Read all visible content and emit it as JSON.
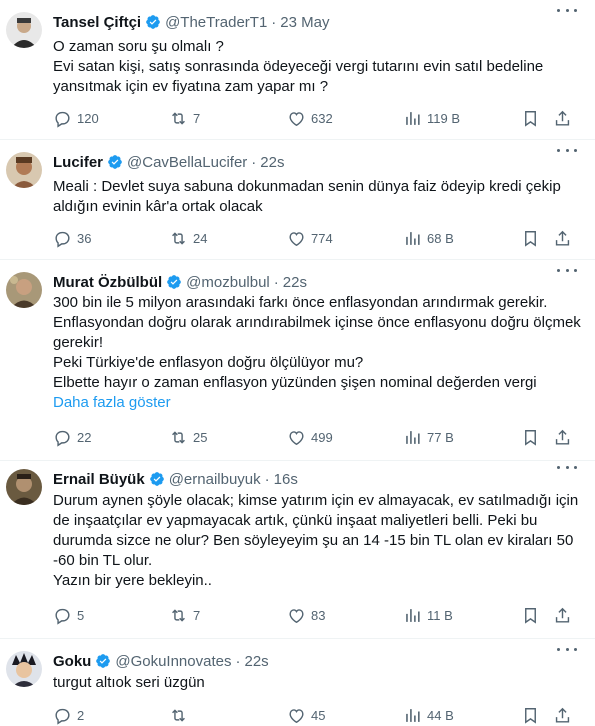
{
  "tweets": [
    {
      "name": "Tansel Çiftçi",
      "handle": "@TheTraderT1",
      "time": "23 May",
      "text": "O zaman soru şu olmalı ?\nEvi satan kişi, satış sonrasında ödeyeceği vergi tutarını evin satıl bedeline yansıtmak için ev fiyatına zam yapar mı ?",
      "show_more": "",
      "replies": "120",
      "retweets": "7",
      "likes": "632",
      "views": "119 B",
      "avatar_color": "#4a4a4a"
    },
    {
      "name": "Lucifer",
      "handle": "@CavBellaLucifer",
      "time": "22s",
      "text": "Meali : Devlet suya sabuna dokunmadan senin dünya faiz ödeyip kredi çekip aldığın evinin  kâr'a ortak  olacak",
      "show_more": "",
      "replies": "36",
      "retweets": "24",
      "likes": "774",
      "views": "68 B",
      "avatar_color": "#8a5a3c"
    },
    {
      "name": "Murat Özbülbül",
      "handle": "@mozbulbul",
      "time": "22s",
      "text": "300 bin ile 5 milyon arasındaki farkı önce enflasyondan arındırmak gerekir. Enflasyondan doğru olarak arındırabilmek içinse önce enflasyonu doğru ölçmek gerekir!\nPeki Türkiye'de enflasyon doğru ölçülüyor mu?\nElbette hayır o zaman enflasyon yüzünden şişen nominal değerden vergi",
      "show_more": "Daha fazla göster",
      "replies": "22",
      "retweets": "25",
      "likes": "499",
      "views": "77 B",
      "avatar_color": "#7a6a4a"
    },
    {
      "name": "Ernail Büyük",
      "handle": "@ernailbuyuk",
      "time": "16s",
      "text": "Durum aynen şöyle olacak; kimse yatırım için ev almayacak, ev satılmadığı için de inşaatçılar ev yapmayacak  artık, çünkü inşaat maliyetleri belli. Peki bu durumda sizce ne olur? Ben söyleyeyim şu an 14 -15 bin TL olan ev kiraları 50 -60 bin TL olur.\nYazın bir yere bekleyin..",
      "show_more": "",
      "replies": "5",
      "retweets": "7",
      "likes": "83",
      "views": "11 B",
      "avatar_color": "#5c4a32"
    },
    {
      "name": "Goku",
      "handle": "@GokuInnovates",
      "time": "22s",
      "text": "turgut altıok seri üzgün",
      "show_more": "",
      "replies": "2",
      "retweets": "",
      "likes": "45",
      "views": "44 B",
      "avatar_color": "#2d2d3a"
    }
  ],
  "colors": {
    "accent": "#1d9bf0",
    "muted": "#536471",
    "text": "#0f1419",
    "border": "#eff3f4"
  },
  "icons": [
    "verified-badge-icon",
    "more-icon",
    "reply-icon",
    "retweet-icon",
    "like-icon",
    "views-icon",
    "bookmark-icon",
    "share-icon"
  ]
}
